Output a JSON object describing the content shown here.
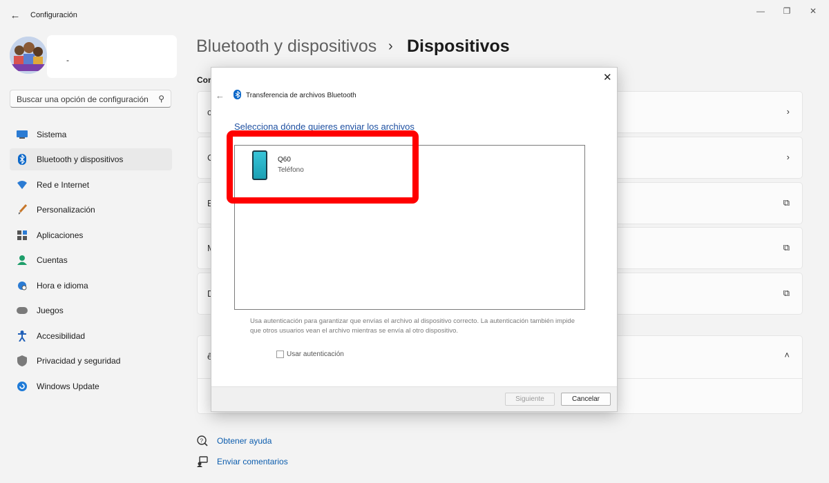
{
  "window": {
    "title": "Configuración",
    "back_glyph": "←",
    "minimize_glyph": "—",
    "maximize_glyph": "❐",
    "close_glyph": "✕"
  },
  "profile": {
    "name": "-"
  },
  "search": {
    "placeholder": "Buscar una opción de configuración",
    "icon": "search-icon"
  },
  "sidebar": {
    "items": [
      {
        "label": "Sistema",
        "icon": "system-icon",
        "active": false
      },
      {
        "label": "Bluetooth y dispositivos",
        "icon": "bluetooth-icon",
        "active": true
      },
      {
        "label": "Red e Internet",
        "icon": "wifi-icon",
        "active": false
      },
      {
        "label": "Personalización",
        "icon": "brush-icon",
        "active": false
      },
      {
        "label": "Aplicaciones",
        "icon": "apps-icon",
        "active": false
      },
      {
        "label": "Cuentas",
        "icon": "person-icon",
        "active": false
      },
      {
        "label": "Hora e idioma",
        "icon": "globe-icon",
        "active": false
      },
      {
        "label": "Juegos",
        "icon": "gamepad-icon",
        "active": false
      },
      {
        "label": "Accesibilidad",
        "icon": "accessibility-icon",
        "active": false
      },
      {
        "label": "Privacidad y seguridad",
        "icon": "shield-icon",
        "active": false
      },
      {
        "label": "Windows Update",
        "icon": "update-icon",
        "active": false
      }
    ]
  },
  "breadcrumb": {
    "parent": "Bluetooth y dispositivos",
    "separator": "›",
    "current": "Dispositivos"
  },
  "section": {
    "label": "Con"
  },
  "cards": [
    {
      "letter": "c",
      "action_icon": "chevron-right-icon",
      "glyph": "›"
    },
    {
      "letter": "C",
      "action_icon": "chevron-right-icon",
      "glyph": "›"
    },
    {
      "letter": "E",
      "action_icon": "external-link-icon",
      "glyph": "⧉"
    },
    {
      "letter": "M",
      "action_icon": "external-link-icon",
      "glyph": "⧉"
    },
    {
      "letter": "D",
      "action_icon": "external-link-icon",
      "glyph": "⧉"
    }
  ],
  "expander": {
    "letter": "ê",
    "glyph": "˄"
  },
  "help": {
    "get_help": "Obtener ayuda",
    "send_feedback": "Enviar comentarios"
  },
  "dialog": {
    "title": "Transferencia de archivos Bluetooth",
    "close_glyph": "✕",
    "back_glyph": "←",
    "heading": "Selecciona dónde quieres enviar los archivos",
    "devices": [
      {
        "name": "Q60",
        "type": "Teléfono"
      }
    ],
    "note": "Usa autenticación para garantizar que envías el archivo al dispositivo correcto. La autenticación también impide que otros usuarios vean el archivo mientras se envía al otro dispositivo.",
    "auth_checkbox_label": "Usar autenticación",
    "auth_checked": false,
    "next_label": "Siguiente",
    "cancel_label": "Cancelar"
  },
  "colors": {
    "accent": "#0067c0",
    "highlight": "#ff0000",
    "link": "#0b5cad"
  }
}
